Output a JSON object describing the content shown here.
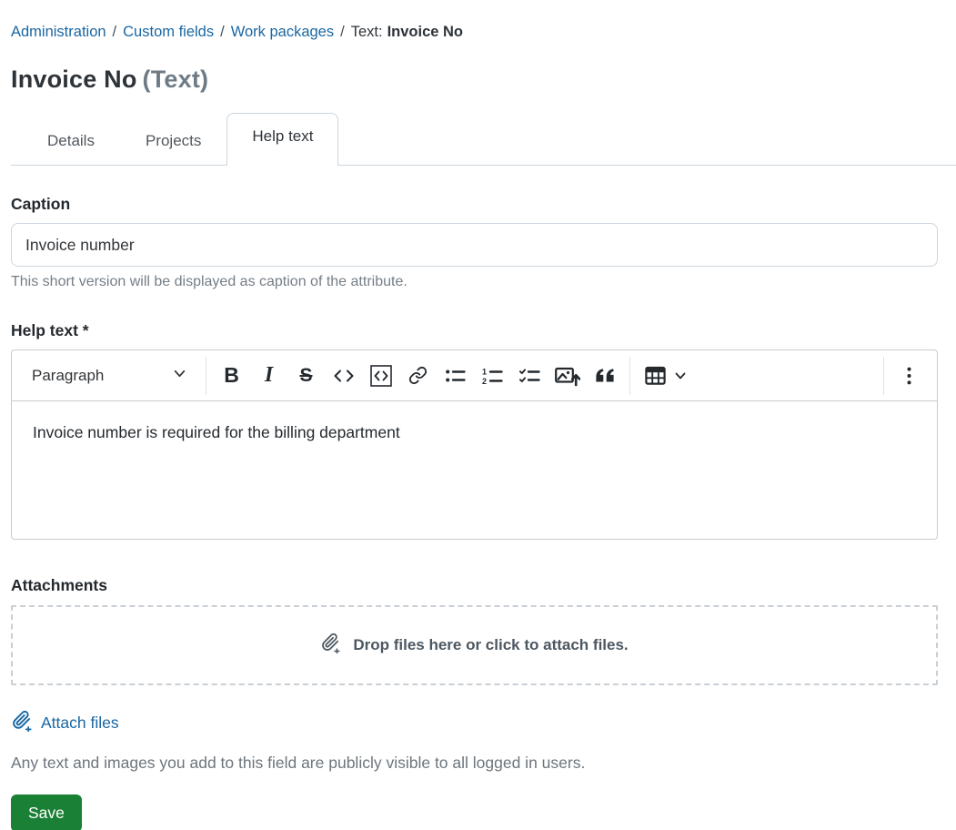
{
  "breadcrumb": {
    "separator": "/",
    "items": [
      {
        "label": "Administration",
        "type": "link"
      },
      {
        "label": "Custom fields",
        "type": "link"
      },
      {
        "label": "Work packages",
        "type": "link"
      },
      {
        "label": "Text:",
        "type": "text"
      },
      {
        "label": "Invoice No",
        "type": "current"
      }
    ]
  },
  "header": {
    "title": "Invoice No",
    "type_suffix": "(Text)"
  },
  "tabs": [
    {
      "label": "Details",
      "active": false
    },
    {
      "label": "Projects",
      "active": false
    },
    {
      "label": "Help text",
      "active": true
    }
  ],
  "form": {
    "caption": {
      "label": "Caption",
      "value": "Invoice number",
      "hint": "This short version will be displayed as caption of the attribute."
    },
    "help_text": {
      "label": "Help text *",
      "content": "Invoice number is required for the billing department"
    },
    "editor": {
      "paragraph_dropdown_value": "Paragraph",
      "toolbar_icons": [
        "paragraph-style-dropdown",
        "bold-icon",
        "italic-icon",
        "strikethrough-icon",
        "inline-code-icon",
        "code-block-icon",
        "link-icon",
        "bulleted-list-icon",
        "numbered-list-icon",
        "task-list-icon",
        "image-upload-icon",
        "block-quote-icon",
        "insert-table-icon",
        "more-options-kebab-icon"
      ]
    },
    "attachments": {
      "label": "Attachments",
      "dropzone_text": "Drop files here or click to attach files.",
      "attach_link_label": "Attach files"
    },
    "notice": "Any text and images you add to this field are publicly visible to all logged in users.",
    "save_label": "Save"
  },
  "colors": {
    "link_blue": "#1a67a3",
    "save_green": "#1a8035",
    "tab_border": "#ccd5dc",
    "muted_text": "#6c757d",
    "dropzone_text": "#4d5760"
  }
}
